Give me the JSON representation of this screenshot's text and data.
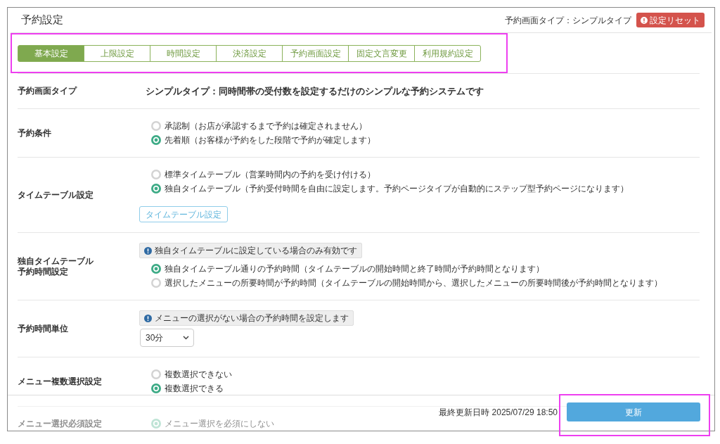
{
  "header": {
    "title": "予約設定",
    "screen_type": "予約画面タイプ：シンプルタイプ",
    "reset_button": "設定リセット"
  },
  "tabs": {
    "highlighted": true,
    "items": [
      {
        "label": "基本設定",
        "selected": true
      },
      {
        "label": "上限設定",
        "selected": false
      },
      {
        "label": "時間設定",
        "selected": false
      },
      {
        "label": "決済設定",
        "selected": false
      },
      {
        "label": "予約画面設定",
        "selected": false
      },
      {
        "label": "固定文言変更",
        "selected": false
      },
      {
        "label": "利用規約設定",
        "selected": false
      }
    ]
  },
  "settings": [
    {
      "label": [
        "予約画面タイプ"
      ],
      "kind": "text",
      "covered": false,
      "value": "シンプルタイプ：同時間帯の受付数を設定するだけのシンプルな予約システムです"
    },
    {
      "label": [
        "予約条件"
      ],
      "kind": "radio",
      "covered": false,
      "options": [
        {
          "label": "承認制（お店が承認するまで予約は確定されません）",
          "selected": false
        },
        {
          "label": "先着順（お客様が予約をした段階で予約が確定します）",
          "selected": true
        }
      ]
    },
    {
      "label": [
        "タイムテーブル設定"
      ],
      "kind": "radio",
      "covered": false,
      "options": [
        {
          "label": "標準タイムテーブル（営業時間内の予約を受け付ける）",
          "selected": false
        },
        {
          "label": "独自タイムテーブル（予約受付時間を自由に設定します。予約ページタイプが自動的にステップ型予約ページになります）",
          "selected": true
        }
      ],
      "button": "タイムテーブル設定"
    },
    {
      "label": [
        "独自タイムテーブル",
        "予約時間設定"
      ],
      "kind": "radio",
      "covered": false,
      "note": "独自タイムテーブルに設定している場合のみ有効です",
      "options": [
        {
          "label": "独自タイムテーブル通りの予約時間（タイムテーブルの開始時間と終了時間が予約時間となります）",
          "selected": true
        },
        {
          "label": "選択したメニューの所要時間が予約時間（タイムテーブルの開始時間から、選択したメニューの所要時間後が予約時間となります）",
          "selected": false
        }
      ]
    },
    {
      "label": [
        "予約時間単位"
      ],
      "kind": "select",
      "covered": false,
      "note": "メニューの選択がない場合の予約時間を設定します",
      "value": "30分"
    },
    {
      "label": [
        "メニュー複数選択設定"
      ],
      "kind": "radio",
      "covered": false,
      "options": [
        {
          "label": "複数選択できない",
          "selected": false
        },
        {
          "label": "複数選択できる",
          "selected": true
        }
      ]
    },
    {
      "label": [
        "メニュー選択必須設定"
      ],
      "kind": "radio",
      "covered": true,
      "options": [
        {
          "label": "メニュー選択を必須にしない",
          "selected": true
        }
      ]
    }
  ],
  "footer": {
    "updated": "最終更新日時 2025/07/29 18:50",
    "save_button": "更新",
    "highlighted": true
  }
}
